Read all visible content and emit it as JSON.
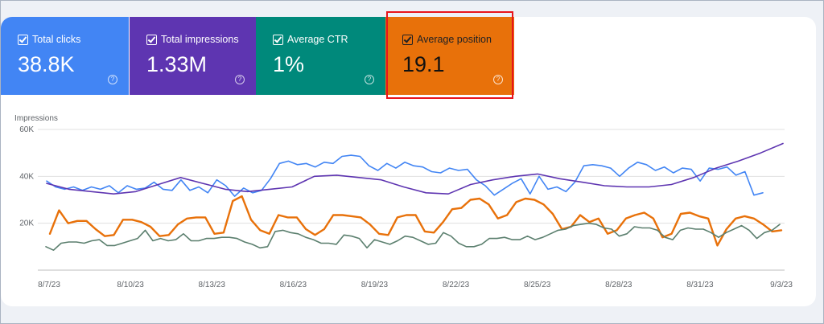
{
  "metrics": {
    "clicks": {
      "label": "Total clicks",
      "value": "38.8K",
      "color": "#4285f4"
    },
    "impressions": {
      "label": "Total impressions",
      "value": "1.33M",
      "color": "#5e35b1"
    },
    "ctr": {
      "label": "Average CTR",
      "value": "1%",
      "color": "#00897b"
    },
    "position": {
      "label": "Average position",
      "value": "19.1",
      "color": "#e8710a"
    }
  },
  "chart_data": {
    "type": "line",
    "ylabel": "Impressions",
    "yticks": [
      "60K",
      "40K",
      "20K"
    ],
    "ylim": [
      0,
      60000
    ],
    "xticks": [
      "8/7/23",
      "8/10/23",
      "8/13/23",
      "8/16/23",
      "8/19/23",
      "8/22/23",
      "8/25/23",
      "8/28/23",
      "8/31/23",
      "9/3/23"
    ],
    "grid": true,
    "series": [
      {
        "color": "#4285f4",
        "values": [
          38000,
          35500,
          34500,
          35500,
          34000,
          35500,
          34500,
          36000,
          33000,
          36000,
          34500,
          35000,
          37500,
          34500,
          34000,
          38500,
          34000,
          35500,
          33000,
          38500,
          36000,
          31500,
          35000,
          33000,
          34000,
          39000,
          45500,
          46500,
          45000,
          45500,
          44000,
          46000,
          45500,
          48500,
          49000,
          48500,
          44500,
          42500,
          45500,
          43500,
          46000,
          44500,
          44000,
          42000,
          41500,
          43500,
          42500,
          43000,
          38500,
          36000,
          32000,
          34500,
          37000,
          39000,
          32500,
          40000,
          34500,
          35500,
          33500,
          37500,
          44500,
          45000,
          44500,
          43500,
          40000,
          43500,
          46000,
          45000,
          42500,
          44000,
          41500,
          43500,
          43000,
          38000,
          43500,
          43000,
          44000,
          40500,
          42000,
          32000,
          33000
        ]
      },
      {
        "color": "#5e35b1",
        "values": [
          37000,
          34500,
          33500,
          32500,
          33500,
          36500,
          39500,
          37000,
          34500,
          33500,
          34500,
          35500,
          40000,
          40500,
          39500,
          38500,
          35500,
          33000,
          32500,
          36500,
          38500,
          40000,
          41000,
          39000,
          37500,
          36000,
          35500,
          35500,
          36500,
          39500,
          43500,
          46500,
          50000,
          54000
        ]
      },
      {
        "color": "#e8710a",
        "values": [
          15500,
          25500,
          20000,
          21000,
          21000,
          17500,
          14500,
          15000,
          21500,
          21500,
          20500,
          18500,
          14500,
          15000,
          19500,
          22000,
          22500,
          22500,
          15500,
          16000,
          29500,
          31500,
          21500,
          17000,
          15500,
          23500,
          22500,
          22500,
          17500,
          15000,
          17500,
          23500,
          23500,
          23000,
          22500,
          19500,
          15500,
          15000,
          22500,
          23500,
          23500,
          16500,
          16000,
          20500,
          26000,
          26500,
          30000,
          30500,
          28000,
          22000,
          23500,
          29000,
          30500,
          30000,
          28000,
          24000,
          17500,
          18500,
          23500,
          20500,
          22000,
          15500,
          17000,
          22000,
          23500,
          24500,
          22000,
          14000,
          15500,
          24000,
          24500,
          23000,
          22000,
          10500,
          17500,
          22000,
          23000,
          22000,
          19500,
          16500,
          17000
        ]
      },
      {
        "color": "#5b7f6e",
        "values": [
          10000,
          8500,
          11500,
          12000,
          12000,
          11500,
          12500,
          13000,
          10500,
          10500,
          11500,
          12500,
          13500,
          17000,
          12500,
          13500,
          12500,
          13000,
          15500,
          12500,
          12500,
          13500,
          13500,
          14000,
          14000,
          13500,
          12000,
          11000,
          9500,
          10000,
          16500,
          17000,
          16000,
          15500,
          14000,
          13000,
          11500,
          11500,
          11000,
          15000,
          14500,
          13500,
          9500,
          13000,
          12000,
          11000,
          12500,
          14500,
          14000,
          12500,
          11000,
          11500,
          16000,
          14500,
          11500,
          10000,
          10000,
          11000,
          13500,
          13500,
          14000,
          13000,
          13000,
          14500,
          13000,
          14000,
          15500,
          17000,
          17500,
          19000,
          19500,
          20000,
          19500,
          18000,
          17500,
          14500,
          15500,
          18500,
          18000,
          18000,
          17000,
          14000,
          13000,
          17000,
          18000,
          17500,
          17500,
          16000,
          14000,
          16000,
          17500,
          19000,
          17000,
          13500,
          16000,
          17000,
          19500
        ]
      }
    ]
  }
}
